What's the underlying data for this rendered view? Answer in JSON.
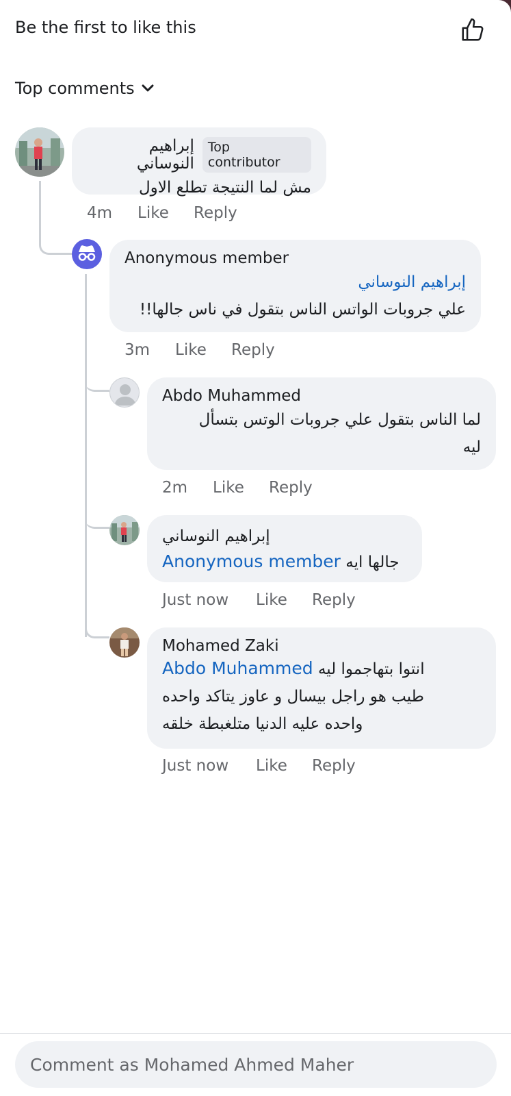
{
  "header": {
    "like_summary": "Be the first to like this",
    "like_icon": "thumbs-up-outline-icon"
  },
  "sort": {
    "label": "Top comments",
    "icon": "chevron-down-icon"
  },
  "comments": [
    {
      "author": "إبراهيم النوساني",
      "badge": "Top contributor",
      "text": "مش لما النتيجة تطلع الاول",
      "time": "4m",
      "like": "Like",
      "reply": "Reply"
    },
    {
      "author": "Anonymous member",
      "mention": "إبراهيم النوساني",
      "text": "علي جروبات الواتس الناس بتقول في ناس جالها!!",
      "time": "3m",
      "like": "Like",
      "reply": "Reply",
      "avatar_icon": "anonymous-icon"
    },
    {
      "author": "Abdo Muhammed",
      "text_line1": "لما الناس بتقول علي جروبات الوتس بتسأل",
      "text_line2": "ليه",
      "time": "2m",
      "like": "Like",
      "reply": "Reply",
      "avatar_icon": "default-user-icon"
    },
    {
      "author": "إبراهيم النوساني",
      "mention": "Anonymous member",
      "text": "جالها ايه",
      "time": "Just now",
      "like": "Like",
      "reply": "Reply"
    },
    {
      "author": "Mohamed Zaki",
      "mention": "Abdo Muhammed",
      "text_line1": "انتوا بتهاجموا ليه",
      "text_line2": "طيب هو راجل بيسال و عاوز يتاكد واحده",
      "text_line3": "واحده عليه الدنيا متلغبطة خلقه",
      "time": "Just now",
      "like": "Like",
      "reply": "Reply"
    }
  ],
  "composer": {
    "placeholder": "Comment as Mohamed Ahmed Maher"
  },
  "colors": {
    "accent_link": "#1565c0",
    "bubble_bg": "#f0f2f5",
    "meta_text": "#65676b",
    "anon_avatar": "#5b5fe0"
  }
}
